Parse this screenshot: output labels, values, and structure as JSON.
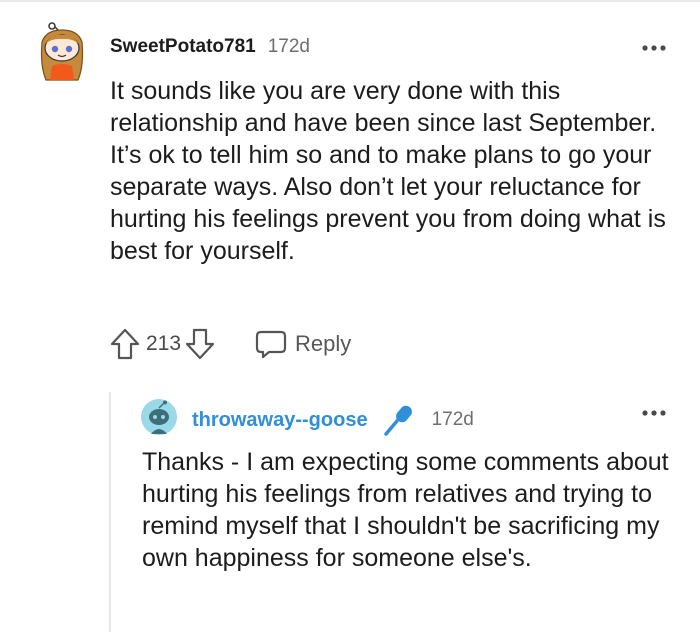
{
  "comments": [
    {
      "username": "SweetPotato781",
      "time": "172d",
      "body": "It sounds like you are very done with this relationship and have been since last September. It’s ok to tell him so and to make plans to go your separate ways. Also don’t let your reluctance for hurting his feelings prevent you from doing what is best for yourself.",
      "score": "213",
      "reply_label": "Reply",
      "avatar_icon": "snoo-avatar-icon",
      "more_icon": "more-options-icon"
    },
    {
      "username": "throwaway--goose",
      "time": "172d",
      "body": "Thanks - I am expecting some comments about hurting his feelings from relatives and trying to remind myself that I shouldn't be sacrificing my own happiness for someone else's.",
      "username_color": "#2f8fd8",
      "flair_icon": "microphone-icon",
      "avatar_icon": "snoo-avatar-icon",
      "more_icon": "more-options-icon"
    }
  ]
}
